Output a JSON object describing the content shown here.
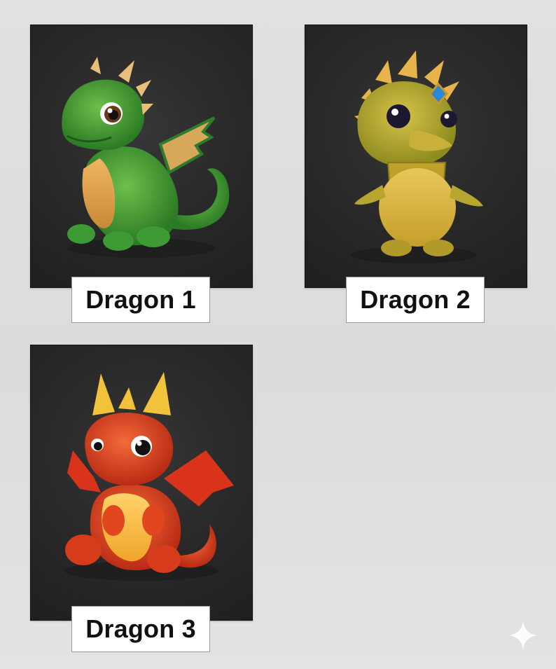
{
  "dragons": [
    {
      "label": "Dragon 1",
      "color": "#3f8f2f",
      "image": "green-dragon-illustration"
    },
    {
      "label": "Dragon 2",
      "color": "#b9a52a",
      "image": "yellow-dragon-illustration"
    },
    {
      "label": "Dragon 3",
      "color": "#e2461f",
      "image": "red-dragon-illustration"
    }
  ],
  "watermark": {
    "icon": "sparkle-icon"
  }
}
